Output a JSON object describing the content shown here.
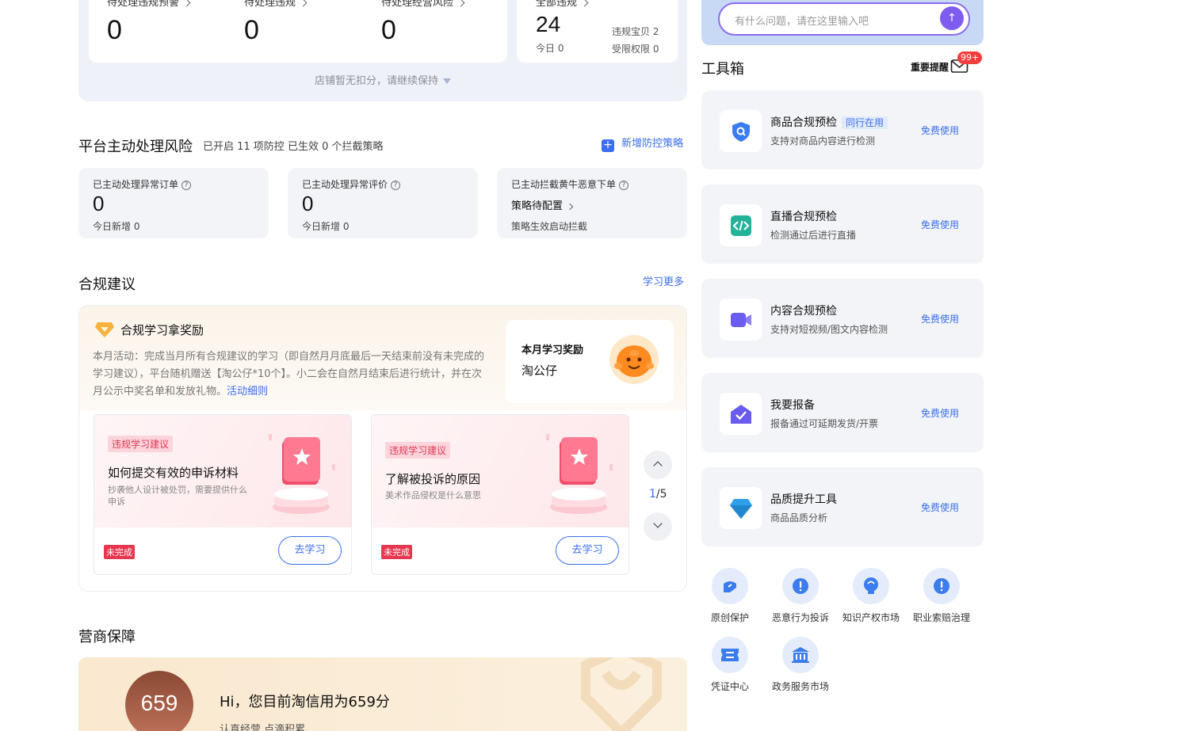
{
  "top_stats": {
    "items": [
      {
        "label": "待处理违规预警",
        "value": "0"
      },
      {
        "label": "待处理违规",
        "value": "0"
      },
      {
        "label": "待处理经营风险",
        "value": "0"
      }
    ],
    "all_violations": {
      "label": "全部违规",
      "value": "24",
      "today": "今日 0",
      "violating_items": "违规宝贝 2",
      "restricted_rights": "受限权限 0"
    },
    "no_penalty_text": "店铺暂无扣分，请继续保持"
  },
  "risk_section": {
    "title": "平台主动处理风险",
    "subtitle": "已开启 11 项防控 已生效 0 个拦截策略",
    "add_strategy": "新增防控策略",
    "cards": [
      {
        "label": "已主动处理异常订单",
        "value": "0",
        "sub": "今日新增 0"
      },
      {
        "label": "已主动处理异常评价",
        "value": "0",
        "sub": "今日新增 0"
      },
      {
        "label": "已主动拦截黄牛恶意下单",
        "value": "策略待配置",
        "sub": "策略生效启动拦截"
      }
    ]
  },
  "compliance": {
    "title": "合规建议",
    "learn_more": "学习更多",
    "reward": {
      "title": "合规学习拿奖励",
      "desc": "本月活动：完成当月所有合规建议的学习（即自然月月底最后一天结束前没有未完成的学习建议），平台随机赠送【淘公仔*10个】。小二会在自然月结束后进行统计，并在次月公示中奖名单和发放礼物。",
      "detail_link": "活动细则",
      "monthly_label": "本月学习奖励",
      "monthly_prize": "淘公仔"
    },
    "cards": [
      {
        "tag": "违规学习建议",
        "title": "如何提交有效的申诉材料",
        "desc": "抄袭他人设计被处罚，需要提供什么申诉",
        "status": "未完成",
        "button": "去学习"
      },
      {
        "tag": "违规学习建议",
        "title": "了解被投诉的原因",
        "desc": "美术作品侵权是什么意思",
        "status": "未完成",
        "button": "去学习"
      }
    ],
    "pager": {
      "current": "1",
      "total": "/5"
    }
  },
  "guarantee": {
    "title": "营商保障",
    "score": "659",
    "greeting": "Hi，您目前淘信用为659分",
    "sub": "认真经营 点滴积累"
  },
  "chat": {
    "placeholder": "有什么问题，请在这里输入吧",
    "send_icon": "arrow-up-icon"
  },
  "toolbox": {
    "title": "工具箱",
    "important_reminder": "重要提醒",
    "badge": "99+",
    "tools": [
      {
        "name": "商品合规预检",
        "tag": "同行在用",
        "desc": "支持对商品内容进行检测",
        "action": "免费使用",
        "icon": "shield-search-icon",
        "color": "#3b7cf0"
      },
      {
        "name": "直播合规预检",
        "tag": "",
        "desc": "检测通过后进行直播",
        "action": "免费使用",
        "icon": "code-icon",
        "color": "#24b39a"
      },
      {
        "name": "内容合规预检",
        "tag": "",
        "desc": "支持对短视频/图文内容检测",
        "action": "免费使用",
        "icon": "video-camera-icon",
        "color": "#6a5cf0"
      },
      {
        "name": "我要报备",
        "tag": "",
        "desc": "报备通过可延期发货/开票",
        "action": "免费使用",
        "icon": "mail-check-icon",
        "color": "#6a5cf0"
      },
      {
        "name": "品质提升工具",
        "tag": "",
        "desc": "商品品质分析",
        "action": "免费使用",
        "icon": "diamond-icon",
        "color": "#2ea0e8"
      }
    ],
    "quick_links": [
      {
        "label": "原创保护",
        "icon": "original-protect-icon"
      },
      {
        "label": "恶意行为投诉",
        "icon": "alert-icon"
      },
      {
        "label": "知识产权市场",
        "icon": "bulb-icon"
      },
      {
        "label": "职业索赔治理",
        "icon": "alert-icon"
      },
      {
        "label": "凭证中心",
        "icon": "ticket-icon"
      },
      {
        "label": "政务服务市场",
        "icon": "government-icon"
      }
    ]
  }
}
